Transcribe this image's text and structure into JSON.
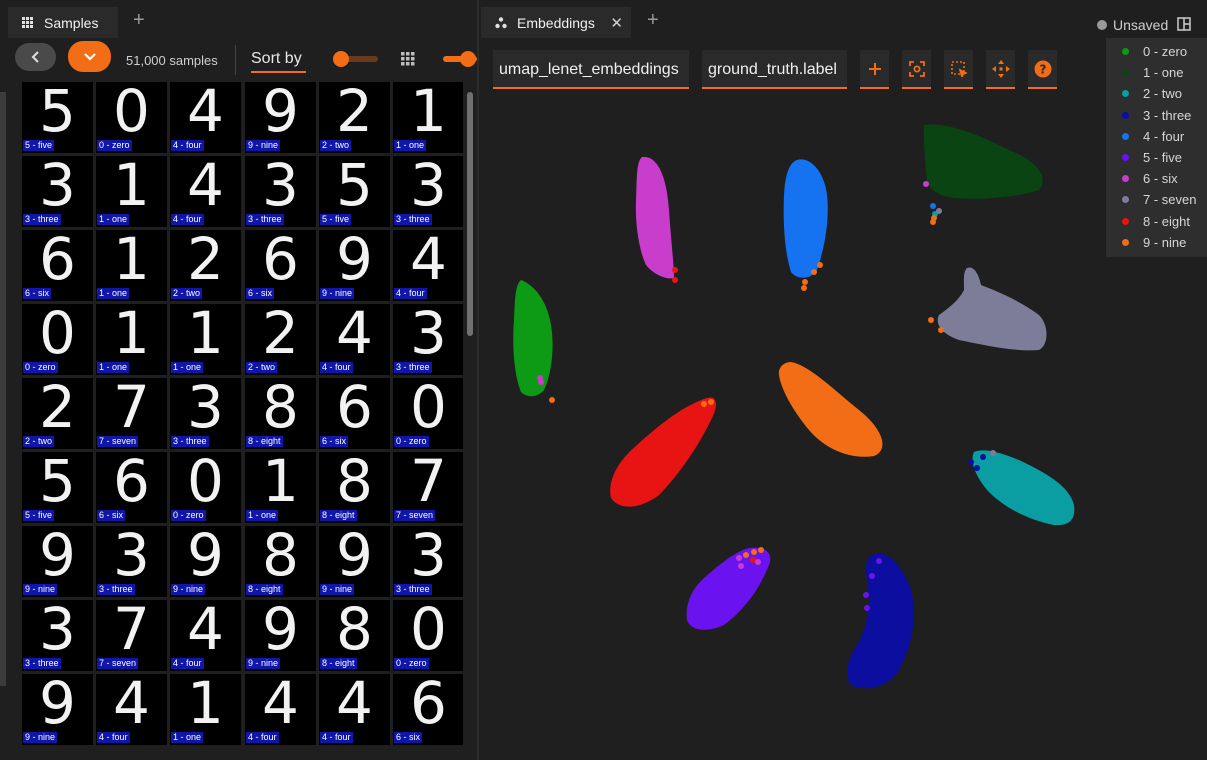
{
  "samples_tab": {
    "title": "Samples",
    "icon": "grid-apps-icon"
  },
  "embeddings_tab": {
    "title": "Embeddings",
    "icon": "scatter-dots-icon"
  },
  "toolbar": {
    "count_text": "51,000 samples",
    "sort_label": "Sort by"
  },
  "status": {
    "unsaved_label": "Unsaved"
  },
  "embeddings_toolbar": {
    "brain_key": "umap_lenet_embeddings",
    "color_by": "ground_truth.label",
    "buttons": [
      "add-icon",
      "zoom-to-selection-icon",
      "lasso-select-icon",
      "pan-icon",
      "help-icon"
    ]
  },
  "legend": [
    {
      "label": "0 - zero",
      "color": "#0d9a14"
    },
    {
      "label": "1 - one",
      "color": "#0b4413"
    },
    {
      "label": "2 - two",
      "color": "#0a9da2"
    },
    {
      "label": "3 - three",
      "color": "#0b0e9e"
    },
    {
      "label": "4 - four",
      "color": "#1572f0"
    },
    {
      "label": "5 - five",
      "color": "#6b12f0"
    },
    {
      "label": "6 - six",
      "color": "#c93dcc"
    },
    {
      "label": "7 - seven",
      "color": "#7d7d9a"
    },
    {
      "label": "8 - eight",
      "color": "#e81414"
    },
    {
      "label": "9 - nine",
      "color": "#f26d15"
    }
  ],
  "samples": [
    {
      "digit": "5",
      "label": "5 - five"
    },
    {
      "digit": "0",
      "label": "0 - zero"
    },
    {
      "digit": "4",
      "label": "4 - four"
    },
    {
      "digit": "9",
      "label": "9 - nine"
    },
    {
      "digit": "2",
      "label": "2 - two"
    },
    {
      "digit": "1",
      "label": "1 - one"
    },
    {
      "digit": "3",
      "label": "3 - three"
    },
    {
      "digit": "1",
      "label": "1 - one"
    },
    {
      "digit": "4",
      "label": "4 - four"
    },
    {
      "digit": "3",
      "label": "3 - three"
    },
    {
      "digit": "5",
      "label": "5 - five"
    },
    {
      "digit": "3",
      "label": "3 - three"
    },
    {
      "digit": "6",
      "label": "6 - six"
    },
    {
      "digit": "1",
      "label": "1 - one"
    },
    {
      "digit": "2",
      "label": "2 - two"
    },
    {
      "digit": "6",
      "label": "6 - six"
    },
    {
      "digit": "9",
      "label": "9 - nine"
    },
    {
      "digit": "4",
      "label": "4 - four"
    },
    {
      "digit": "0",
      "label": "0 - zero"
    },
    {
      "digit": "1",
      "label": "1 - one"
    },
    {
      "digit": "1",
      "label": "1 - one"
    },
    {
      "digit": "2",
      "label": "2 - two"
    },
    {
      "digit": "4",
      "label": "4 - four"
    },
    {
      "digit": "3",
      "label": "3 - three"
    },
    {
      "digit": "2",
      "label": "2 - two"
    },
    {
      "digit": "7",
      "label": "7 - seven"
    },
    {
      "digit": "3",
      "label": "3 - three"
    },
    {
      "digit": "8",
      "label": "8 - eight"
    },
    {
      "digit": "6",
      "label": "6 - six"
    },
    {
      "digit": "0",
      "label": "0 - zero"
    },
    {
      "digit": "5",
      "label": "5 - five"
    },
    {
      "digit": "6",
      "label": "6 - six"
    },
    {
      "digit": "0",
      "label": "0 - zero"
    },
    {
      "digit": "1",
      "label": "1 - one"
    },
    {
      "digit": "8",
      "label": "8 - eight"
    },
    {
      "digit": "7",
      "label": "7 - seven"
    },
    {
      "digit": "9",
      "label": "9 - nine"
    },
    {
      "digit": "3",
      "label": "3 - three"
    },
    {
      "digit": "9",
      "label": "9 - nine"
    },
    {
      "digit": "8",
      "label": "8 - eight"
    },
    {
      "digit": "9",
      "label": "9 - nine"
    },
    {
      "digit": "3",
      "label": "3 - three"
    },
    {
      "digit": "3",
      "label": "3 - three"
    },
    {
      "digit": "7",
      "label": "7 - seven"
    },
    {
      "digit": "4",
      "label": "4 - four"
    },
    {
      "digit": "9",
      "label": "9 - nine"
    },
    {
      "digit": "8",
      "label": "8 - eight"
    },
    {
      "digit": "0",
      "label": "0 - zero"
    },
    {
      "digit": "9",
      "label": "9 - nine"
    },
    {
      "digit": "4",
      "label": "4 - four"
    },
    {
      "digit": "1",
      "label": "1 - one"
    },
    {
      "digit": "4",
      "label": "4 - four"
    },
    {
      "digit": "4",
      "label": "4 - four"
    },
    {
      "digit": "6",
      "label": "6 - six"
    }
  ]
}
